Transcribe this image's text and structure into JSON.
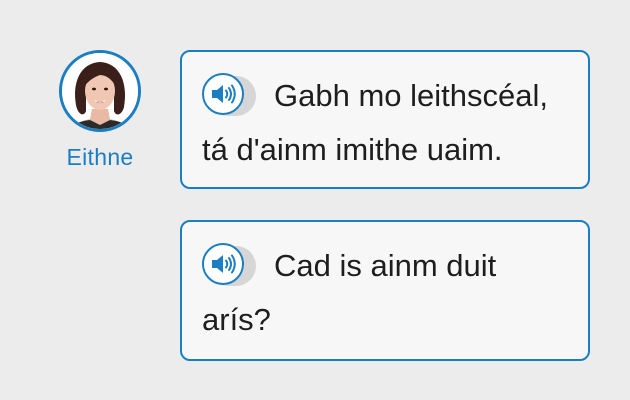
{
  "speaker": {
    "name": "Eithne",
    "avatar_icon": "person-avatar-icon"
  },
  "colors": {
    "accent": "#1c7ec2",
    "bubble_bg": "#f7f7f7",
    "page_bg": "#ececec",
    "text": "#1e1e1e"
  },
  "messages": [
    {
      "audio_icon": "speaker-volume-icon",
      "line1": "Gabh mo leithscéal,",
      "line2": "tá d'ainm imithe uaim."
    },
    {
      "audio_icon": "speaker-volume-icon",
      "line1": "Cad is ainm duit",
      "line2": "arís?"
    }
  ]
}
